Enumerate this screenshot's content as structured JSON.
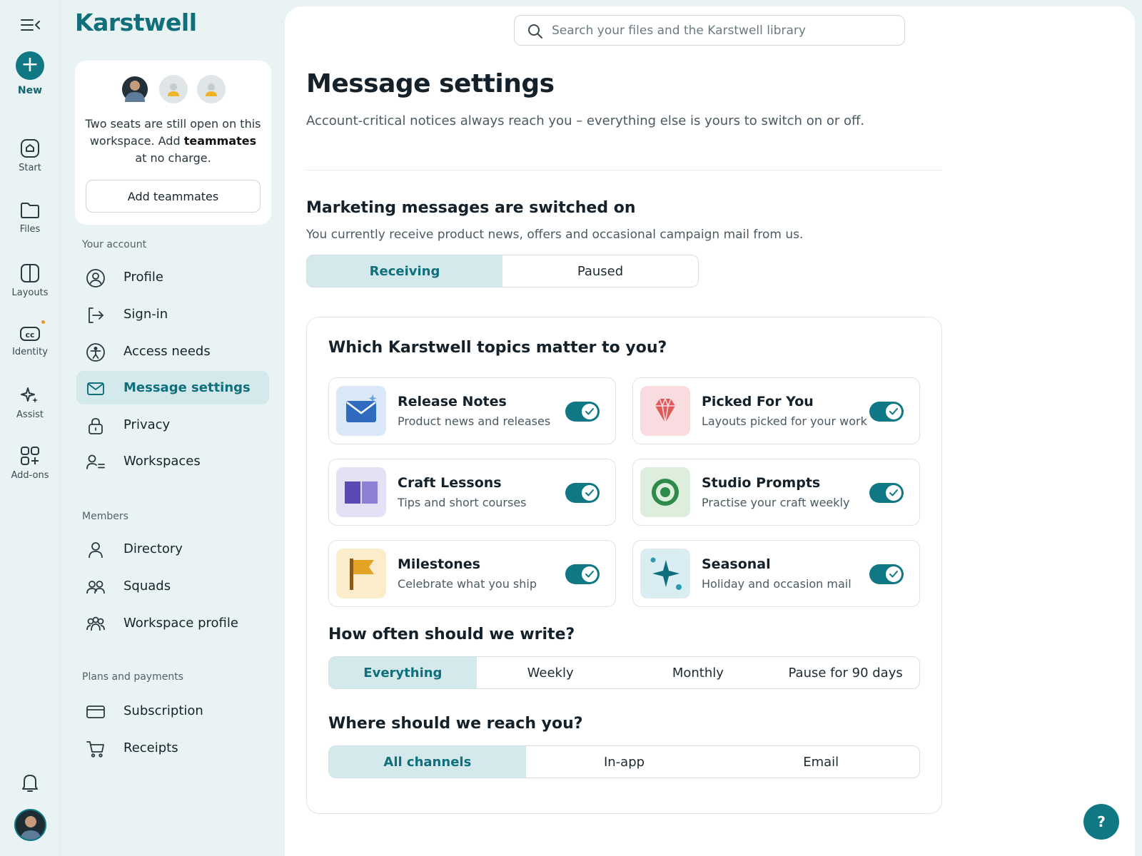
{
  "rail": {
    "new_label": "New",
    "items": [
      {
        "label": "Start",
        "icon": "home-icon"
      },
      {
        "label": "Files",
        "icon": "folder-icon"
      },
      {
        "label": "Layouts",
        "icon": "layouts-icon"
      },
      {
        "label": "Identity",
        "icon": "identity-icon"
      },
      {
        "label": "Assist",
        "icon": "sparkle-icon"
      },
      {
        "label": "Add-ons",
        "icon": "add-ons-icon"
      }
    ]
  },
  "brand": {
    "name": "Karstwell"
  },
  "seats": {
    "text_before": "Two seats are still open on this workspace. Add ",
    "text_bold": "teammates",
    "text_after": " at no charge.",
    "button": "Add teammates"
  },
  "sidebar": {
    "groups": [
      {
        "title": "Your account",
        "items": [
          {
            "label": "Profile",
            "icon": "user-circle-icon"
          },
          {
            "label": "Sign-in",
            "icon": "sign-in-icon"
          },
          {
            "label": "Access needs",
            "icon": "accessibility-icon"
          },
          {
            "label": "Message settings",
            "icon": "mail-icon",
            "active": true
          },
          {
            "label": "Privacy",
            "icon": "lock-icon"
          },
          {
            "label": "Workspaces",
            "icon": "user-list-icon"
          }
        ]
      },
      {
        "title": "Members",
        "items": [
          {
            "label": "Directory",
            "icon": "person-icon"
          },
          {
            "label": "Squads",
            "icon": "people-icon"
          },
          {
            "label": "Workspace profile",
            "icon": "group-icon"
          }
        ]
      },
      {
        "title": "Plans and payments",
        "items": [
          {
            "label": "Subscription",
            "icon": "credit-card-icon"
          },
          {
            "label": "Receipts",
            "icon": "cart-icon"
          }
        ]
      }
    ]
  },
  "search": {
    "placeholder": "Search your files and the Karstwell library",
    "value": ""
  },
  "page": {
    "title": "Message settings",
    "subtitle": "Account-critical notices always reach you – everything else is yours to switch on or off."
  },
  "marketing": {
    "title": "Marketing messages are switched on",
    "subtitle": "You currently receive product news, offers and occasional campaign mail from us.",
    "options": [
      "Receiving",
      "Paused"
    ],
    "selected": "Receiving"
  },
  "topics": {
    "title": "Which Karstwell topics matter to you?",
    "items": [
      {
        "name": "Release Notes",
        "desc": "Product news and releases",
        "on": true,
        "icon": "envelope-icon",
        "color": "#dbe8f7"
      },
      {
        "name": "Picked For You",
        "desc": "Layouts picked for your work",
        "on": true,
        "icon": "gem-icon",
        "color": "#f8dcdf"
      },
      {
        "name": "Craft Lessons",
        "desc": "Tips and short courses",
        "on": true,
        "icon": "book-icon",
        "color": "#e6e0f5"
      },
      {
        "name": "Studio Prompts",
        "desc": "Practise your craft weekly",
        "on": true,
        "icon": "target-icon",
        "color": "#ddeedd"
      },
      {
        "name": "Milestones",
        "desc": "Celebrate what you ship",
        "on": true,
        "icon": "flag-icon",
        "color": "#fbeccb"
      },
      {
        "name": "Seasonal",
        "desc": "Holiday and occasion mail",
        "on": true,
        "icon": "sparkle-icon",
        "color": "#d9edf2"
      }
    ]
  },
  "frequency": {
    "title": "How often should we write?",
    "options": [
      "Everything",
      "Weekly",
      "Monthly",
      "Pause for 90 days"
    ],
    "selected": "Everything"
  },
  "channels": {
    "title": "Where should we reach you?",
    "options": [
      "All channels",
      "In-app",
      "Email"
    ],
    "selected": "All channels"
  },
  "help": {
    "label": "?"
  },
  "colors": {
    "accent": "#0f7884",
    "accent_soft": "#d3e9ec",
    "sidebar_bg": "#eaf3f4"
  }
}
